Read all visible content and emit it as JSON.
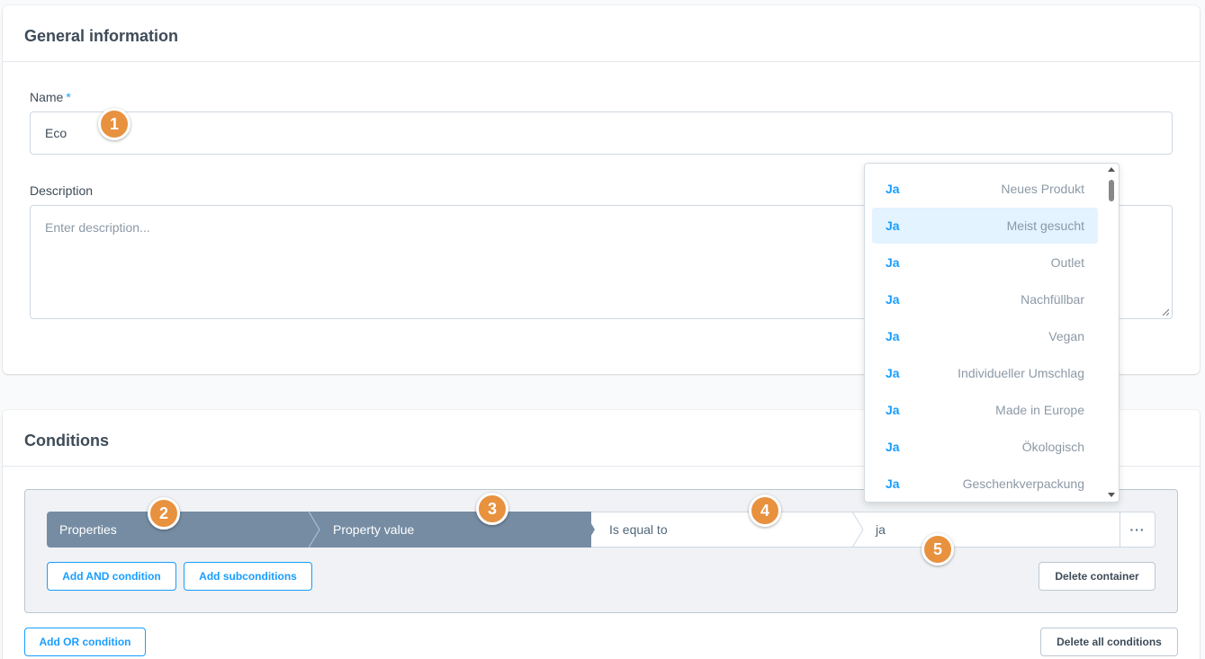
{
  "general": {
    "title": "General information",
    "name_label": "Name",
    "required_marker": "*",
    "name_value": "Eco",
    "description_label": "Description",
    "description_placeholder": "Enter description..."
  },
  "conditions": {
    "title": "Conditions",
    "row": {
      "field": "Properties",
      "subfield": "Property value",
      "operator": "Is equal to",
      "value": "ja",
      "more_label": "···"
    },
    "add_and_label": "Add AND condition",
    "add_sub_label": "Add subconditions",
    "delete_container_label": "Delete container",
    "add_or_label": "Add OR condition",
    "delete_all_label": "Delete all conditions"
  },
  "badges": [
    "1",
    "2",
    "3",
    "4",
    "5"
  ],
  "dropdown": {
    "items": [
      {
        "value": "Ja",
        "label": "Neues Produkt",
        "highlighted": false
      },
      {
        "value": "Ja",
        "label": "Meist gesucht",
        "highlighted": true
      },
      {
        "value": "Ja",
        "label": "Outlet",
        "highlighted": false
      },
      {
        "value": "Ja",
        "label": "Nachfüllbar",
        "highlighted": false
      },
      {
        "value": "Ja",
        "label": "Vegan",
        "highlighted": false
      },
      {
        "value": "Ja",
        "label": "Individueller Umschlag",
        "highlighted": false
      },
      {
        "value": "Ja",
        "label": "Made in Europe",
        "highlighted": false
      },
      {
        "value": "Ja",
        "label": "Ökologisch",
        "highlighted": false
      },
      {
        "value": "Ja",
        "label": "Geschenkverpackung",
        "highlighted": false
      }
    ]
  },
  "colors": {
    "accent": "#189eff",
    "segment_dark": "#758ca3",
    "badge": "#e8913e"
  }
}
